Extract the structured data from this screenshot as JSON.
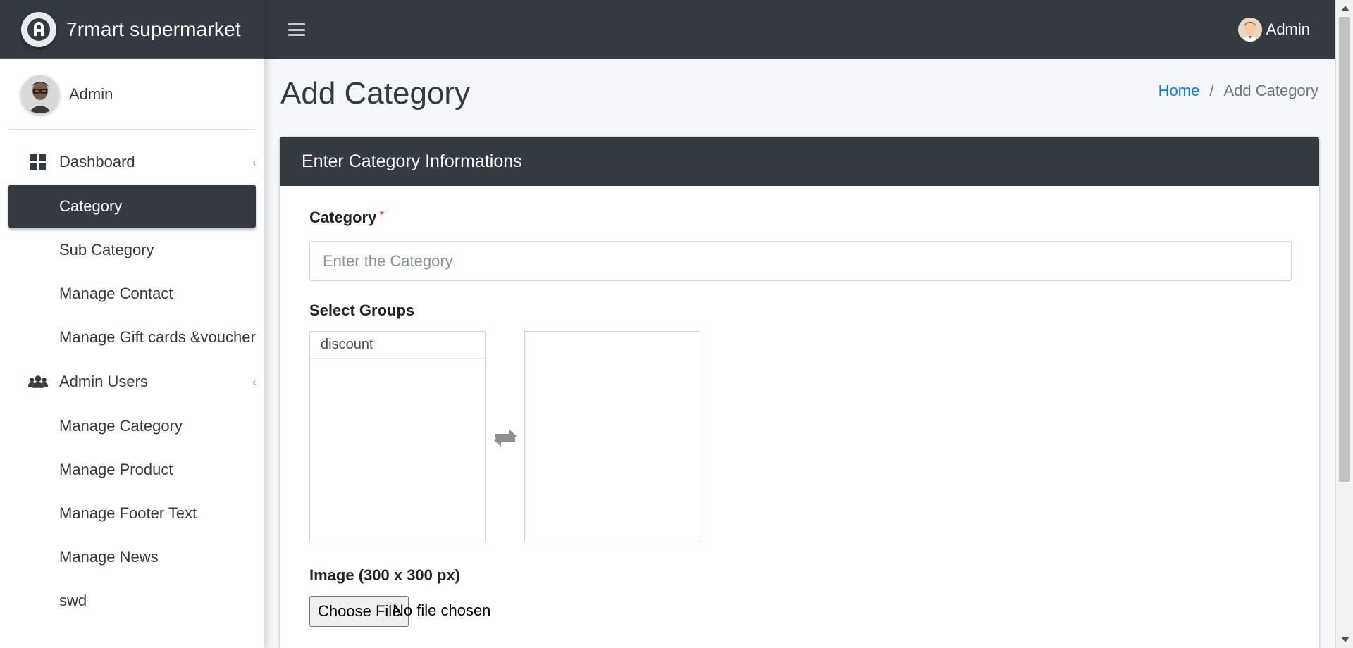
{
  "brand": {
    "name": "7rmart supermarket",
    "logo_icon": "adminlte-logo-icon"
  },
  "sidebar": {
    "user_name": "Admin",
    "items": [
      {
        "label": "Dashboard",
        "icon": "dashboard-grid-icon",
        "has_caret": true,
        "active": false
      },
      {
        "label": "Category",
        "active": true
      },
      {
        "label": "Sub Category",
        "active": false
      },
      {
        "label": "Manage Contact",
        "active": false
      },
      {
        "label": "Manage Gift cards &voucher",
        "active": false
      },
      {
        "label": "Admin Users",
        "icon": "users-icon",
        "has_caret": true,
        "active": false
      },
      {
        "label": "Manage Category",
        "active": false
      },
      {
        "label": "Manage Product",
        "active": false
      },
      {
        "label": "Manage Footer Text",
        "active": false
      },
      {
        "label": "Manage News",
        "active": false
      },
      {
        "label": "swd",
        "active": false
      }
    ]
  },
  "topbar": {
    "user_name": "Admin",
    "menu_icon": "hamburger-icon"
  },
  "page": {
    "title": "Add Category",
    "breadcrumb": {
      "home": "Home",
      "separator": "/",
      "current": "Add Category"
    }
  },
  "form": {
    "header": "Enter Category Informations",
    "category_label": "Category",
    "required_mark": "*",
    "category_placeholder": "Enter the Category",
    "category_value": "",
    "groups_label": "Select Groups",
    "groups_available": [
      "discount"
    ],
    "groups_selected": [],
    "image_label": "Image (300 x 300 px)",
    "file_button": "Choose File",
    "file_status": "No file chosen"
  },
  "colors": {
    "dark": "#343a40",
    "link": "#007bff",
    "required": "#dc3545",
    "background": "#f4f6f9"
  }
}
